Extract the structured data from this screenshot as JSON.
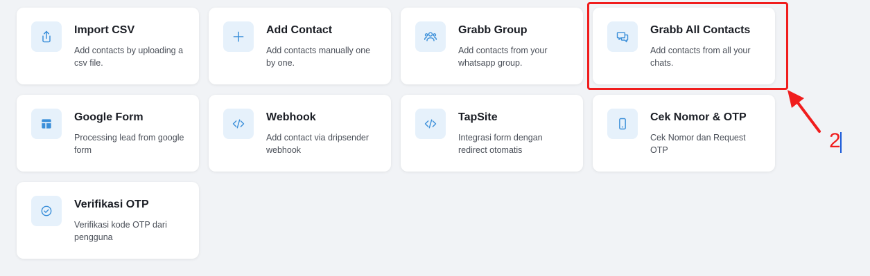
{
  "cards": [
    {
      "title": "Import CSV",
      "desc": "Add contacts by uploading a csv file.",
      "icon": "upload-icon"
    },
    {
      "title": "Add Contact",
      "desc": "Add contacts manually one by one.",
      "icon": "plus-icon"
    },
    {
      "title": "Grabb Group",
      "desc": "Add contacts from your whatsapp group.",
      "icon": "users-icon"
    },
    {
      "title": "Grabb All Contacts",
      "desc": "Add contacts from all your chats.",
      "icon": "chat-bubbles-icon"
    },
    {
      "title": "Google Form",
      "desc": "Processing lead from google form",
      "icon": "form-icon"
    },
    {
      "title": "Webhook",
      "desc": "Add contact via dripsender webhook",
      "icon": "code-icon"
    },
    {
      "title": "TapSite",
      "desc": "Integrasi form dengan redirect otomatis",
      "icon": "code-icon"
    },
    {
      "title": "Cek Nomor & OTP",
      "desc": "Cek Nomor dan Request OTP",
      "icon": "phone-icon"
    },
    {
      "title": "Verifikasi OTP",
      "desc": "Verifikasi kode OTP dari pengguna",
      "icon": "check-circle-icon"
    }
  ],
  "annotation": {
    "label": "2",
    "color": "#f01d1d"
  },
  "colors": {
    "icon_accent": "#3b8fd9",
    "icon_bg": "#e6f1fb",
    "card_bg": "#ffffff",
    "page_bg": "#f1f3f6"
  }
}
